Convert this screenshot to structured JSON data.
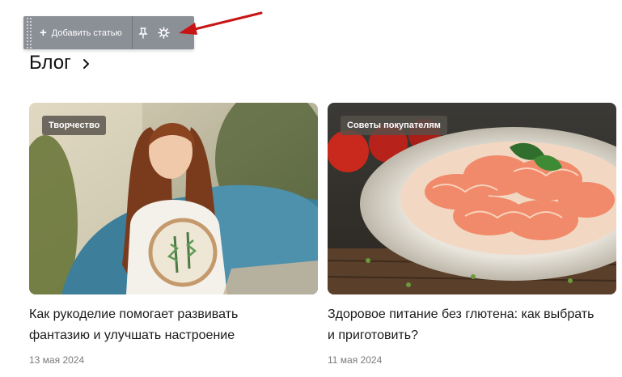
{
  "toolbar": {
    "add_article_label": "Добавить статью",
    "icons": [
      "plus-icon",
      "pin-icon",
      "gear-icon"
    ]
  },
  "annotation": {
    "arrow_color": "#c81414"
  },
  "blog": {
    "title": "Блог",
    "chevron": "›"
  },
  "cards": [
    {
      "tag": "Творчество",
      "title_lines": [
        "Как рукоделие помогает развивать",
        "фантазию и улучшать настроение"
      ],
      "date": "13 мая 2024"
    },
    {
      "tag": "Советы покупателям",
      "title_lines": [
        "Здоровое питание без глютена: как выбрать",
        "и приготовить?"
      ],
      "date": "11 мая 2024"
    }
  ],
  "colors": {
    "toolbar_bg": "#8b8f96",
    "tag_bg": "#55504b",
    "date_text": "#7a7a7a"
  }
}
